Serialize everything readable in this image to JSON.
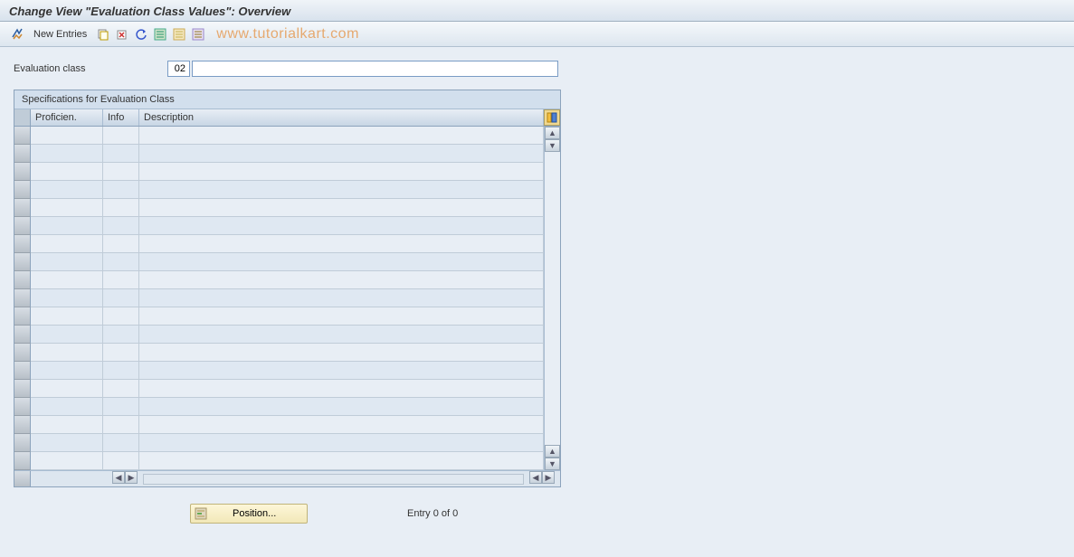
{
  "title": "Change View \"Evaluation Class Values\": Overview",
  "toolbar": {
    "new_entries_label": "New Entries",
    "watermark": "www.tutorialkart.com"
  },
  "field": {
    "label": "Evaluation class",
    "value": "02",
    "description_value": ""
  },
  "table": {
    "panel_title": "Specifications for Evaluation Class",
    "columns": {
      "proficien": "Proficien.",
      "info": "Info",
      "description": "Description"
    },
    "row_count": 19,
    "rows": []
  },
  "footer": {
    "position_label": "Position...",
    "entry_text": "Entry 0 of 0"
  }
}
